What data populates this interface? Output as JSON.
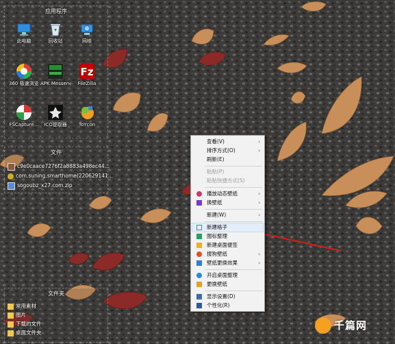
{
  "desktop": {
    "apps_group": {
      "title": "应用程序",
      "icons": [
        {
          "label": "此电脑",
          "icon": "computer-icon"
        },
        {
          "label": "回收站",
          "icon": "recycle-bin-icon"
        },
        {
          "label": "网络",
          "icon": "network-icon"
        },
        {
          "label": "360 极速浏览器X",
          "icon": "browser-360-icon"
        },
        {
          "label": "APK Messenger",
          "icon": "apk-messenger-icon"
        },
        {
          "label": "FileZilla",
          "icon": "filezilla-icon"
        },
        {
          "label": "FSCapture...",
          "icon": "fscapture-icon"
        },
        {
          "label": "ICO提取器",
          "icon": "ico-extractor-icon"
        },
        {
          "label": "ToYcon",
          "icon": "toycon-icon"
        }
      ]
    },
    "files_group": {
      "title": "文件",
      "files": [
        {
          "name": "c9e0caace7276f2a8883a498ec44...",
          "icon": "image-file-icon"
        },
        {
          "name": "com.suning.smarthome(220629141...",
          "icon": "app-file-icon"
        },
        {
          "name": "sogoubz_x27.com.zip",
          "icon": "zip-file-icon"
        }
      ]
    },
    "folders_group": {
      "title": "文件夹",
      "folders": [
        {
          "name": "常用素材",
          "icon": "folder-icon"
        },
        {
          "name": "图片",
          "icon": "folder-icon"
        },
        {
          "name": "下载的文件",
          "icon": "folder-icon"
        },
        {
          "name": "桌面文件夹",
          "icon": "folder-icon"
        }
      ]
    }
  },
  "context_menu": {
    "items": [
      {
        "label": "查看(V)",
        "submenu": true,
        "icon": ""
      },
      {
        "label": "排序方式(O)",
        "submenu": true,
        "icon": ""
      },
      {
        "label": "刷新(E)",
        "submenu": false,
        "icon": ""
      },
      {
        "label": "粘贴(P)",
        "submenu": false,
        "icon": "",
        "disabled": true
      },
      {
        "label": "粘贴快捷方式(S)",
        "submenu": false,
        "icon": "",
        "disabled": true
      },
      {
        "label": "播放动态壁纸",
        "submenu": true,
        "icon": "dynamic-wallpaper-icon"
      },
      {
        "label": "换壁纸",
        "submenu": true,
        "icon": "wallpaper-icon"
      },
      {
        "label": "新建(W)",
        "submenu": true,
        "icon": ""
      },
      {
        "label": "新建格子",
        "submenu": false,
        "icon": "new-grid-icon",
        "highlighted": true
      },
      {
        "label": "图标整理",
        "submenu": false,
        "icon": "icon-organize-icon"
      },
      {
        "label": "新建桌面便签",
        "submenu": false,
        "icon": "sticky-note-icon"
      },
      {
        "label": "搜狗壁纸",
        "submenu": true,
        "icon": "sogou-wallpaper-icon"
      },
      {
        "label": "壁纸更换效果",
        "submenu": true,
        "icon": "wallpaper-effect-icon"
      },
      {
        "label": "开启桌面整理",
        "submenu": false,
        "icon": "desktop-organize-icon"
      },
      {
        "label": "更换壁纸",
        "submenu": false,
        "icon": "change-wallpaper-icon"
      },
      {
        "label": "显示设置(D)",
        "submenu": false,
        "icon": "display-settings-icon"
      },
      {
        "label": "个性化(R)",
        "submenu": false,
        "icon": "personalize-icon"
      }
    ]
  },
  "watermark": {
    "text": "千篇网"
  },
  "colors": {
    "menu_bg": "#f2f2f2",
    "menu_highlight": "#e4eefb",
    "arrow_red": "#d0201c",
    "leaf_tan": "#c98f5a",
    "leaf_red": "#8c2a28"
  }
}
